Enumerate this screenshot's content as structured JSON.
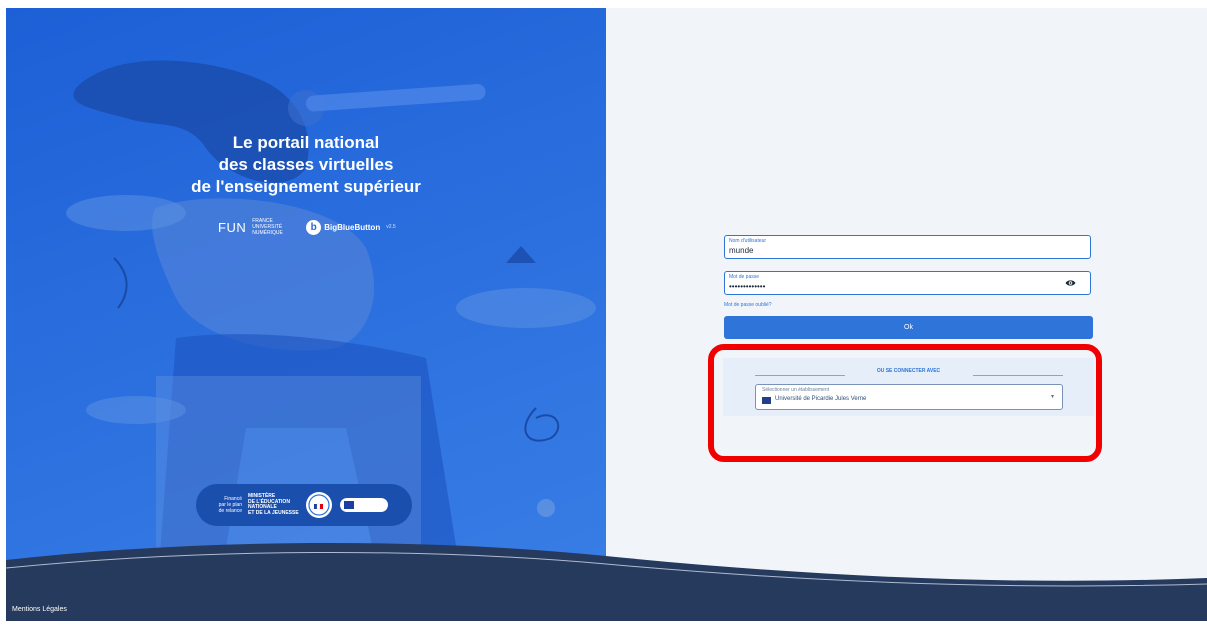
{
  "hero": {
    "tagline": [
      "Le portail national",
      "des classes virtuelles",
      "de l'enseignement supérieur"
    ]
  },
  "partners": {
    "fun": "FUN",
    "fun_sub": [
      "FRANCE",
      "UNIVERSITÉ",
      "NUMÉRIQUE"
    ],
    "bbb_mark": "b",
    "bbb_name": "BigBlueButton",
    "bbb_version": "v2.5"
  },
  "funding": {
    "text": [
      "Financé",
      "par le plan",
      "de relance"
    ],
    "ministry": [
      "MINISTÈRE",
      "DE L'ÉDUCATION",
      "NATIONALE",
      "ET DE LA JEUNESSE"
    ]
  },
  "login": {
    "username_label": "Nom d'utilisateur",
    "username_value": "munde",
    "password_label": "Mot de passe",
    "password_value": "•••••••••••••",
    "forgot_link": "Mot de passe oublié?",
    "submit_label": "Ok"
  },
  "sso": {
    "divider_text": "OU SE CONNECTER AVEC",
    "select_label": "Sélectionner un établissement",
    "select_value": "Université de Picardie Jules Verne"
  },
  "footer": {
    "legal_link": "Mentions Légales"
  },
  "icons": {
    "password_toggle": "eye-icon",
    "dropdown": "chevron-down-icon"
  },
  "colors": {
    "primary": "#2f74d8",
    "hero_bg": "#2a6ede",
    "footer_bg": "#263a5e",
    "highlight": "#f00000"
  }
}
